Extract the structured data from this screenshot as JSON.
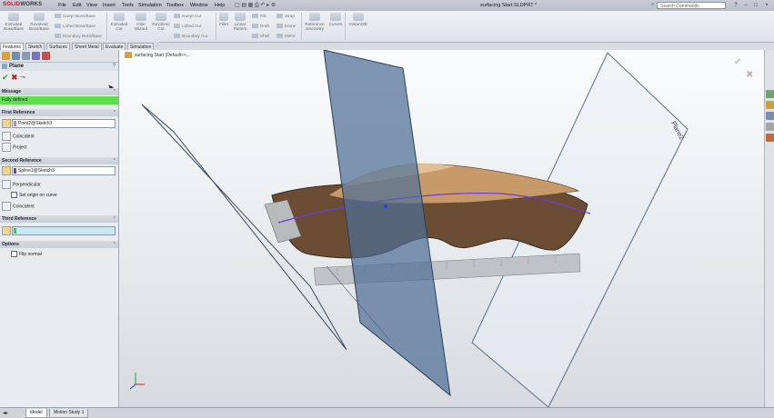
{
  "app": {
    "logo_main": "SOLID",
    "logo_sub": "WORKS",
    "doc_title": "surfacing Start.SLDPRT *"
  },
  "menu": [
    "File",
    "Edit",
    "View",
    "Insert",
    "Tools",
    "Simulation",
    "Toolbox",
    "Window",
    "Help"
  ],
  "search": {
    "placeholder": "Search Commands"
  },
  "commands": {
    "extruded_boss": "Extruded Boss/Base",
    "revolved_boss": "Revolved Boss/Base",
    "swept_boss": "Swept Boss/Base",
    "lofted_boss": "Lofted Boss/Base",
    "boundary_boss": "Boundary Boss/Base",
    "extruded_cut": "Extruded Cut",
    "hole_wizard": "Hole Wizard",
    "revolved_cut": "Revolved Cut",
    "swept_cut": "Swept Cut",
    "lofted_cut": "Lofted Cut",
    "boundary_cut": "Boundary Cut",
    "fillet": "Fillet",
    "linear_pattern": "Linear Pattern",
    "rib": "Rib",
    "draft": "Draft",
    "shell": "Shell",
    "wrap": "Wrap",
    "dome": "Dome",
    "mirror": "Mirror",
    "reference_geometry": "Reference Geometry",
    "curves": "Curves",
    "instant3d": "Instant3D"
  },
  "tabs": [
    "Features",
    "Sketch",
    "Surfaces",
    "Sheet Metal",
    "Evaluate",
    "Simulation"
  ],
  "property_manager": {
    "title": "Plane",
    "message_header": "Message",
    "message": "Fully defined",
    "first_reference": {
      "header": "First Reference",
      "value": "Point2@Sketch3",
      "option1": "Coincident",
      "option2": "Project"
    },
    "second_reference": {
      "header": "Second Reference",
      "value": "Spline1@Sketch3",
      "option1": "Perpendicular",
      "checkbox": "Set origin on curve",
      "option2": "Coincident"
    },
    "third_reference": {
      "header": "Third Reference",
      "value": ""
    },
    "options": {
      "header": "Options",
      "checkbox": "Flip normal"
    }
  },
  "viewport": {
    "breadcrumb": "surfacing Start (Default<<...",
    "plane_label": "Plane2"
  },
  "bottom_tabs": [
    "Model",
    "Motion Study 1"
  ],
  "colors": {
    "accent_green": "#5fe04a",
    "plane_blue": "#4f6f95",
    "tag_pink": "#ef6fb8",
    "tag_purple": "#7b2de0",
    "tag_green": "#2ad44a"
  }
}
